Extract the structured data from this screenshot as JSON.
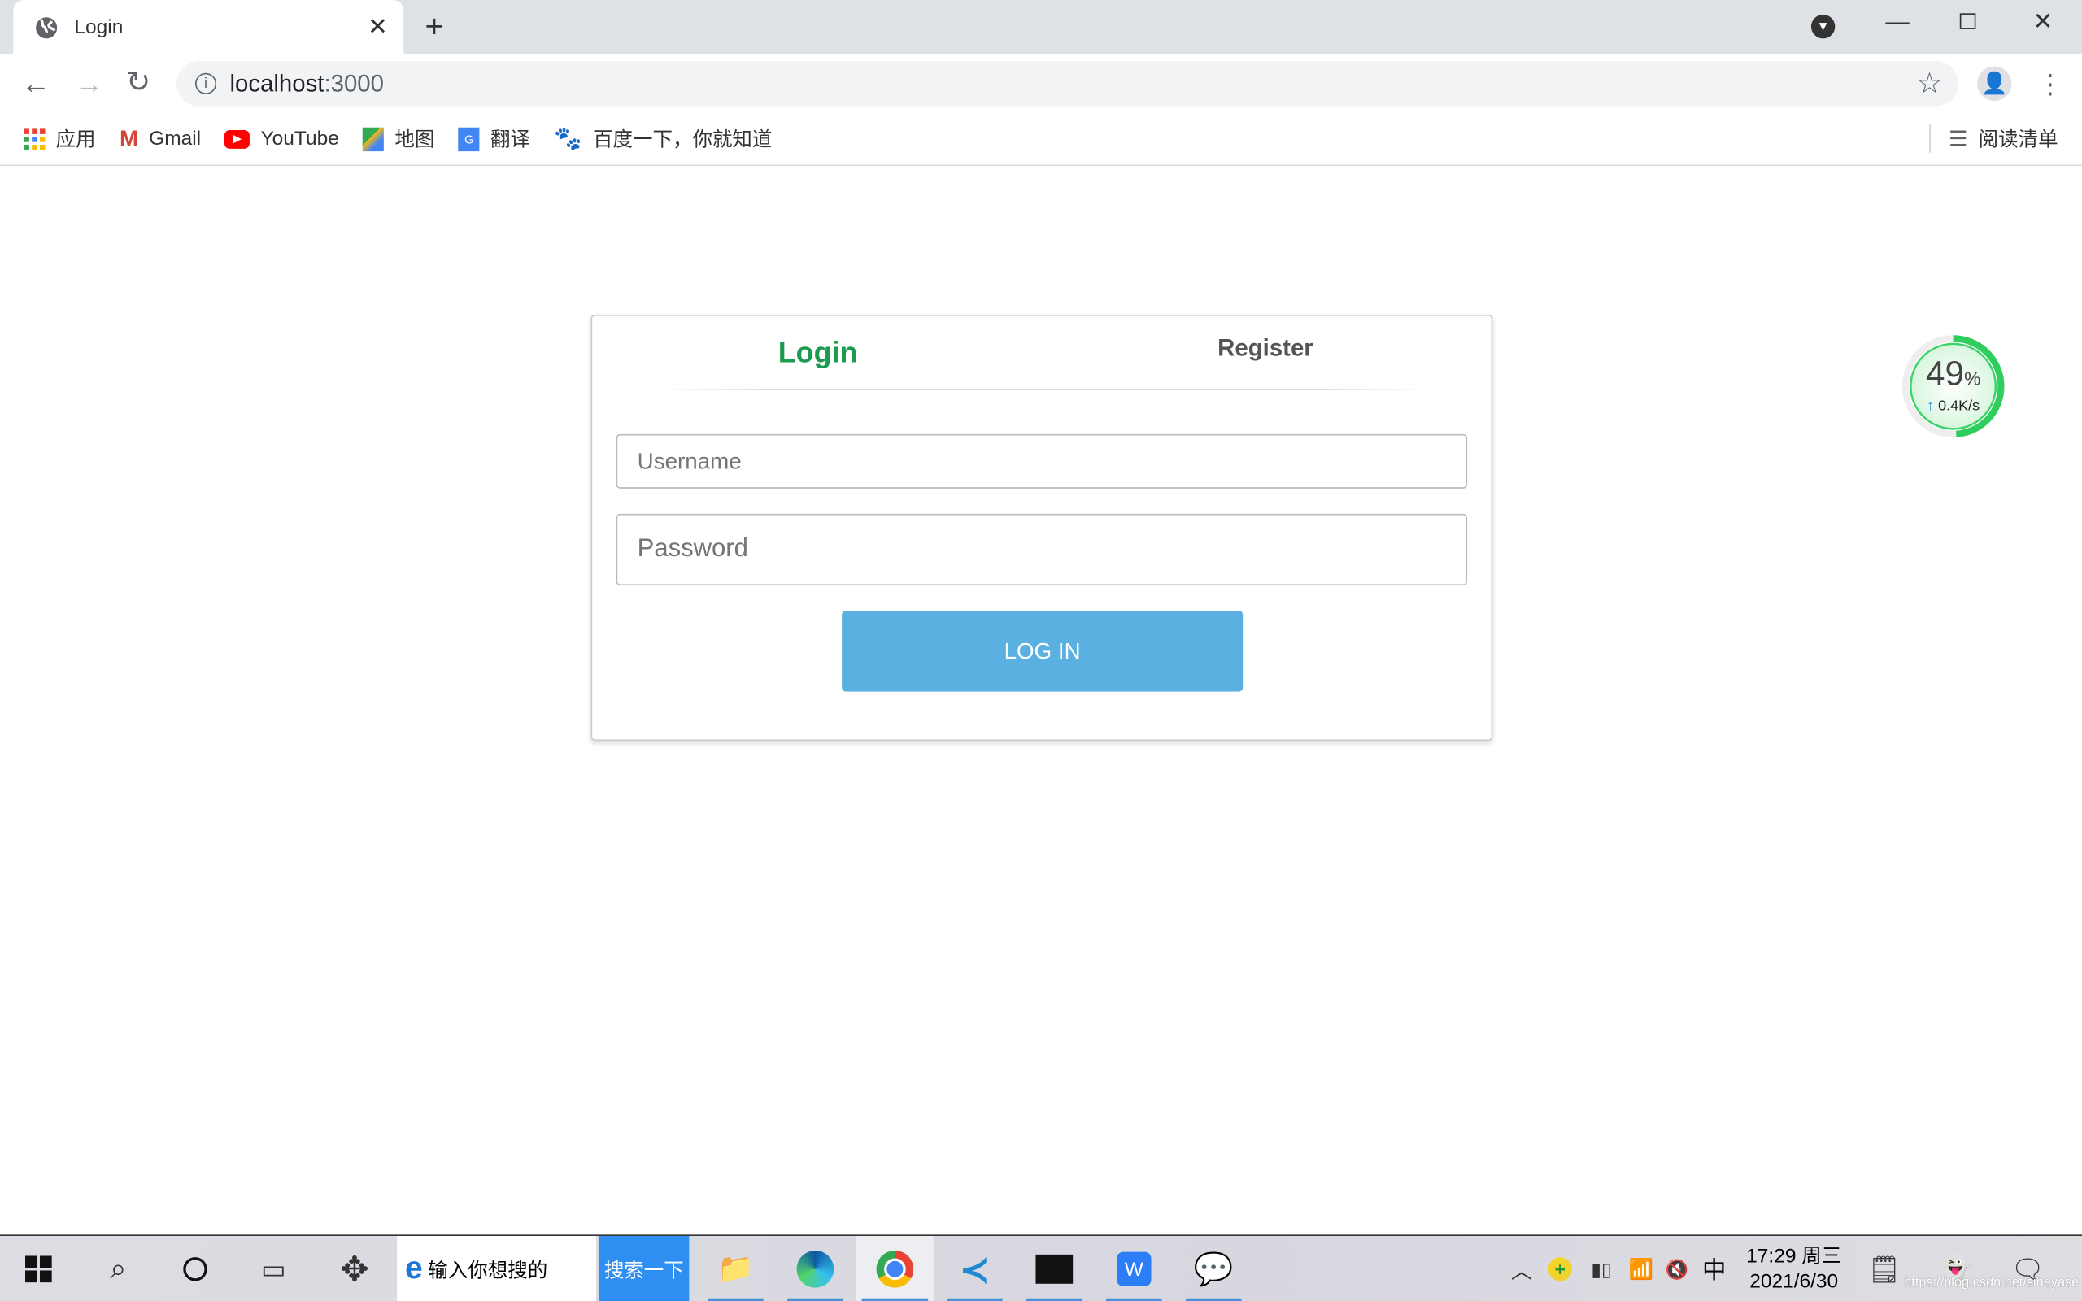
{
  "browser": {
    "tab_title": "Login",
    "url_host": "localhost",
    "url_port": ":3000",
    "bookmarks": [
      {
        "label": "应用",
        "icon": "apps-grid-icon"
      },
      {
        "label": "Gmail",
        "icon": "gmail-icon"
      },
      {
        "label": "YouTube",
        "icon": "youtube-icon"
      },
      {
        "label": "地图",
        "icon": "maps-icon"
      },
      {
        "label": "翻译",
        "icon": "translate-icon"
      },
      {
        "label": "百度一下，你就知道",
        "icon": "baidu-icon"
      }
    ],
    "reading_list": "阅读清单"
  },
  "login": {
    "tabs": [
      {
        "label": "Login",
        "active": true
      },
      {
        "label": "Register",
        "active": false
      }
    ],
    "username_placeholder": "Username",
    "password_placeholder": "Password",
    "submit_label": "LOG IN",
    "accent": "#1a9b50",
    "button_color": "#5ab0e0"
  },
  "widget": {
    "percent": "49",
    "percent_sign": "%",
    "speed": "0.4K/s",
    "level": 49
  },
  "taskbar": {
    "search_placeholder": "输入你想搜的",
    "search_button": "搜索一下",
    "ime": "中",
    "time": "17:29 周三",
    "date": "2021/6/30",
    "watermark": "https://blog.csdn.net/siheyase"
  }
}
